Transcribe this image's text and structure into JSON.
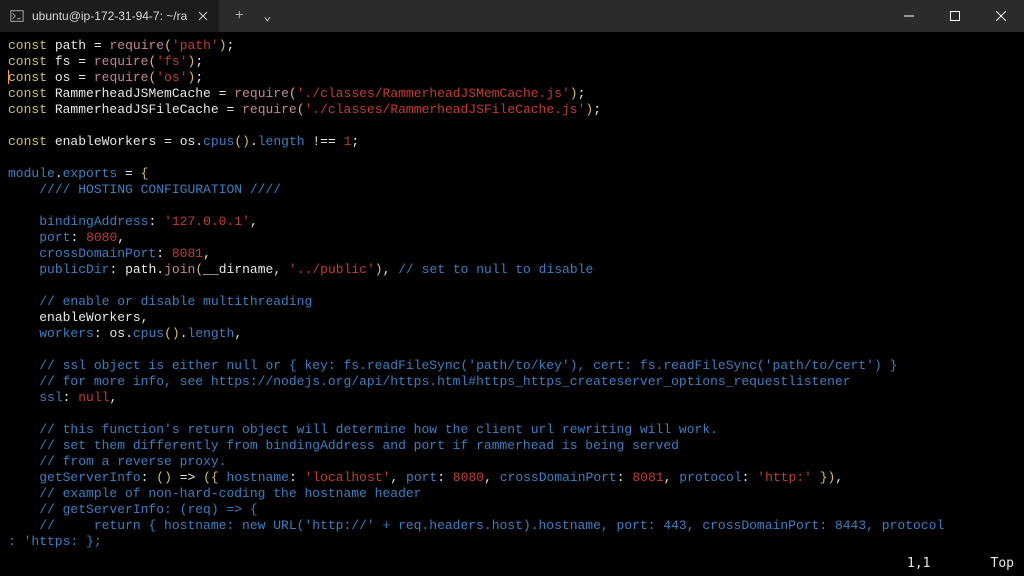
{
  "titlebar": {
    "tab_title": "ubuntu@ip-172-31-94-7: ~/ra",
    "new_tab_glyph": "+",
    "dropdown_glyph": "⌄",
    "close_glyph": "×",
    "min_glyph": "—",
    "max_glyph": "▢",
    "winclose_glyph": "×"
  },
  "status": {
    "pos": "1,1",
    "scroll": "Top"
  },
  "code": {
    "lines": [
      [
        [
          "kw",
          "const"
        ],
        [
          "op",
          " "
        ],
        [
          "id",
          "path"
        ],
        [
          "op",
          " "
        ],
        [
          "op",
          "="
        ],
        [
          "op",
          " "
        ],
        [
          "pk",
          "require"
        ],
        [
          "br",
          "("
        ],
        [
          "st",
          "'path'"
        ],
        [
          "br",
          ")"
        ],
        [
          "op",
          ";"
        ]
      ],
      [
        [
          "kw",
          "const"
        ],
        [
          "op",
          " "
        ],
        [
          "id",
          "fs"
        ],
        [
          "op",
          " "
        ],
        [
          "op",
          "="
        ],
        [
          "op",
          " "
        ],
        [
          "pk",
          "require"
        ],
        [
          "br",
          "("
        ],
        [
          "st",
          "'fs'"
        ],
        [
          "br",
          ")"
        ],
        [
          "op",
          ";"
        ]
      ],
      [
        [
          "kw",
          "const"
        ],
        [
          "op",
          " "
        ],
        [
          "id",
          "os"
        ],
        [
          "op",
          " "
        ],
        [
          "op",
          "="
        ],
        [
          "op",
          " "
        ],
        [
          "pk",
          "require"
        ],
        [
          "br",
          "("
        ],
        [
          "st",
          "'os'"
        ],
        [
          "br",
          ")"
        ],
        [
          "op",
          ";"
        ]
      ],
      [
        [
          "kw",
          "const"
        ],
        [
          "op",
          " "
        ],
        [
          "id",
          "RammerheadJSMemCache"
        ],
        [
          "op",
          " "
        ],
        [
          "op",
          "="
        ],
        [
          "op",
          " "
        ],
        [
          "pk",
          "require"
        ],
        [
          "br",
          "("
        ],
        [
          "st",
          "'./classes/RammerheadJSMemCache.js'"
        ],
        [
          "br",
          ")"
        ],
        [
          "op",
          ";"
        ]
      ],
      [
        [
          "kw",
          "const"
        ],
        [
          "op",
          " "
        ],
        [
          "id",
          "RammerheadJSFileCache"
        ],
        [
          "op",
          " "
        ],
        [
          "op",
          "="
        ],
        [
          "op",
          " "
        ],
        [
          "pk",
          "require"
        ],
        [
          "br",
          "("
        ],
        [
          "st",
          "'./classes/RammerheadJSFileCache.js'"
        ],
        [
          "br",
          ")"
        ],
        [
          "op",
          ";"
        ]
      ],
      [],
      [
        [
          "kw",
          "const"
        ],
        [
          "op",
          " "
        ],
        [
          "id",
          "enableWorkers"
        ],
        [
          "op",
          " "
        ],
        [
          "op",
          "="
        ],
        [
          "op",
          " "
        ],
        [
          "id",
          "os"
        ],
        [
          "op",
          "."
        ],
        [
          "bl",
          "cpus"
        ],
        [
          "br",
          "()"
        ],
        [
          "op",
          "."
        ],
        [
          "bl",
          "length"
        ],
        [
          "op",
          " "
        ],
        [
          "op",
          "!=="
        ],
        [
          "op",
          " "
        ],
        [
          "nu",
          "1"
        ],
        [
          "op",
          ";"
        ]
      ],
      [],
      [
        [
          "bl",
          "module"
        ],
        [
          "op",
          "."
        ],
        [
          "bl",
          "exports"
        ],
        [
          "op",
          " "
        ],
        [
          "op",
          "="
        ],
        [
          "op",
          " "
        ],
        [
          "br",
          "{"
        ]
      ],
      [
        [
          "op",
          "    "
        ],
        [
          "cm",
          "//// HOSTING CONFIGURATION ////"
        ]
      ],
      [],
      [
        [
          "op",
          "    "
        ],
        [
          "bl",
          "bindingAddress"
        ],
        [
          "op",
          ":"
        ],
        [
          "op",
          " "
        ],
        [
          "st",
          "'127.0.0.1'"
        ],
        [
          "op",
          ","
        ]
      ],
      [
        [
          "op",
          "    "
        ],
        [
          "bl",
          "port"
        ],
        [
          "op",
          ":"
        ],
        [
          "op",
          " "
        ],
        [
          "nu",
          "8080"
        ],
        [
          "op",
          ","
        ]
      ],
      [
        [
          "op",
          "    "
        ],
        [
          "bl",
          "crossDomainPort"
        ],
        [
          "op",
          ":"
        ],
        [
          "op",
          " "
        ],
        [
          "nu",
          "8081"
        ],
        [
          "op",
          ","
        ]
      ],
      [
        [
          "op",
          "    "
        ],
        [
          "bl",
          "publicDir"
        ],
        [
          "op",
          ":"
        ],
        [
          "op",
          " "
        ],
        [
          "id",
          "path"
        ],
        [
          "op",
          "."
        ],
        [
          "pk",
          "join"
        ],
        [
          "br",
          "("
        ],
        [
          "id",
          "__dirname"
        ],
        [
          "op",
          ","
        ],
        [
          "op",
          " "
        ],
        [
          "st",
          "'../public'"
        ],
        [
          "br",
          ")"
        ],
        [
          "op",
          ","
        ],
        [
          "op",
          " "
        ],
        [
          "cm",
          "// set to null to disable"
        ]
      ],
      [],
      [
        [
          "op",
          "    "
        ],
        [
          "cm",
          "// enable or disable multithreading"
        ]
      ],
      [
        [
          "op",
          "    "
        ],
        [
          "id",
          "enableWorkers"
        ],
        [
          "op",
          ","
        ]
      ],
      [
        [
          "op",
          "    "
        ],
        [
          "bl",
          "workers"
        ],
        [
          "op",
          ":"
        ],
        [
          "op",
          " "
        ],
        [
          "id",
          "os"
        ],
        [
          "op",
          "."
        ],
        [
          "bl",
          "cpus"
        ],
        [
          "br",
          "()"
        ],
        [
          "op",
          "."
        ],
        [
          "bl",
          "length"
        ],
        [
          "op",
          ","
        ]
      ],
      [],
      [
        [
          "op",
          "    "
        ],
        [
          "cm",
          "// ssl object is either null or { key: fs.readFileSync('path/to/key'), cert: fs.readFileSync('path/to/cert') }"
        ]
      ],
      [
        [
          "op",
          "    "
        ],
        [
          "cm",
          "// for more info, see https://nodejs.org/api/https.html#https_https_createserver_options_requestlistener"
        ]
      ],
      [
        [
          "op",
          "    "
        ],
        [
          "bl",
          "ssl"
        ],
        [
          "op",
          ":"
        ],
        [
          "op",
          " "
        ],
        [
          "nl",
          "null"
        ],
        [
          "op",
          ","
        ]
      ],
      [],
      [
        [
          "op",
          "    "
        ],
        [
          "cm",
          "// this function's return object will determine how the client url rewriting will work."
        ]
      ],
      [
        [
          "op",
          "    "
        ],
        [
          "cm",
          "// set them differently from bindingAddress and port if rammerhead is being served"
        ]
      ],
      [
        [
          "op",
          "    "
        ],
        [
          "cm",
          "// from a reverse proxy."
        ]
      ],
      [
        [
          "op",
          "    "
        ],
        [
          "bl",
          "getServerInfo"
        ],
        [
          "op",
          ":"
        ],
        [
          "op",
          " "
        ],
        [
          "br",
          "()"
        ],
        [
          "op",
          " "
        ],
        [
          "op",
          "=>"
        ],
        [
          "op",
          " "
        ],
        [
          "br",
          "({"
        ],
        [
          "op",
          " "
        ],
        [
          "bl",
          "hostname"
        ],
        [
          "op",
          ":"
        ],
        [
          "op",
          " "
        ],
        [
          "st",
          "'localhost'"
        ],
        [
          "op",
          ","
        ],
        [
          "op",
          " "
        ],
        [
          "bl",
          "port"
        ],
        [
          "op",
          ":"
        ],
        [
          "op",
          " "
        ],
        [
          "nu",
          "8080"
        ],
        [
          "op",
          ","
        ],
        [
          "op",
          " "
        ],
        [
          "bl",
          "crossDomainPort"
        ],
        [
          "op",
          ":"
        ],
        [
          "op",
          " "
        ],
        [
          "nu",
          "8081"
        ],
        [
          "op",
          ","
        ],
        [
          "op",
          " "
        ],
        [
          "bl",
          "protocol"
        ],
        [
          "op",
          ":"
        ],
        [
          "op",
          " "
        ],
        [
          "st",
          "'http:'"
        ],
        [
          "op",
          " "
        ],
        [
          "br",
          "})"
        ],
        [
          "op",
          ","
        ]
      ],
      [
        [
          "op",
          "    "
        ],
        [
          "cm",
          "// example of non-hard-coding the hostname header"
        ]
      ],
      [
        [
          "op",
          "    "
        ],
        [
          "cm",
          "// getServerInfo: (req) => {"
        ]
      ],
      [
        [
          "op",
          "    "
        ],
        [
          "cm",
          "//     return { hostname: new URL('http://' + req.headers.host).hostname, port: 443, crossDomainPort: 8443, protocol"
        ]
      ],
      [
        [
          "cm",
          ": 'https: };"
        ]
      ]
    ]
  }
}
